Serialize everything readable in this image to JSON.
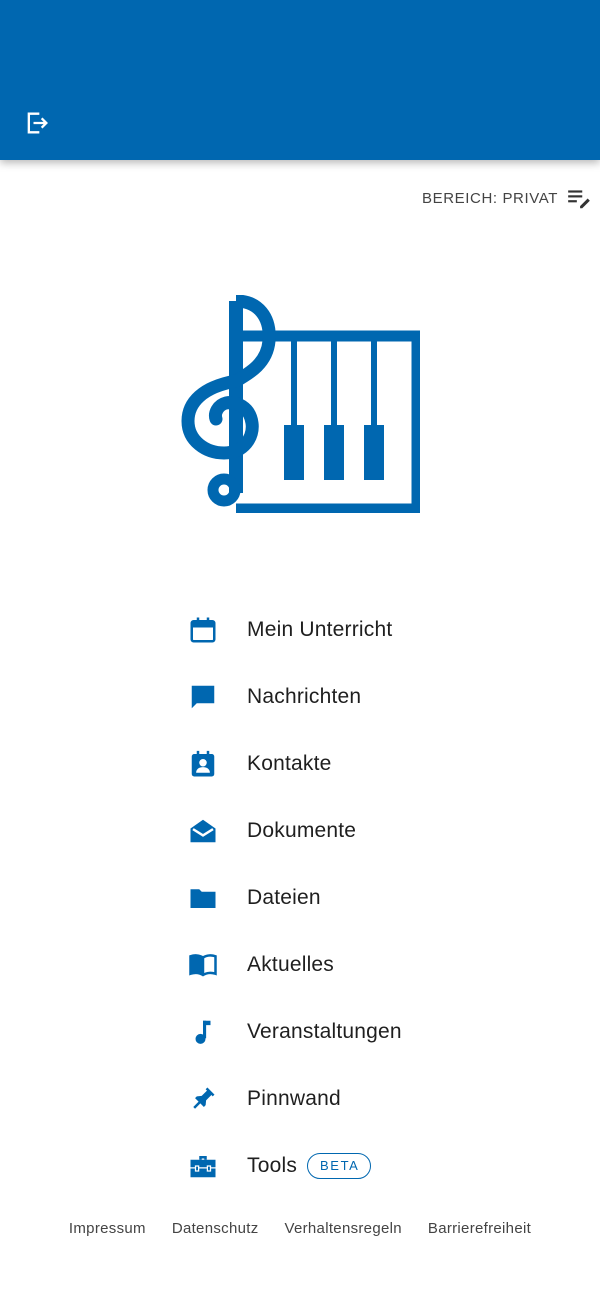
{
  "header": {
    "logout_icon": "logout-icon",
    "background_color": "#0067b0"
  },
  "area": {
    "label": "BEREICH: PRIVAT",
    "icon": "edit-list-icon"
  },
  "logo": {
    "icon": "treble-clef-piano-logo",
    "color": "#0067b0"
  },
  "menu": {
    "items": [
      {
        "label": "Mein Unterricht",
        "icon": "calendar-icon"
      },
      {
        "label": "Nachrichten",
        "icon": "chat-icon"
      },
      {
        "label": "Kontakte",
        "icon": "contact-card-icon"
      },
      {
        "label": "Dokumente",
        "icon": "envelope-open-icon"
      },
      {
        "label": "Dateien",
        "icon": "folder-icon"
      },
      {
        "label": "Aktuelles",
        "icon": "book-open-icon"
      },
      {
        "label": "Veranstaltungen",
        "icon": "music-note-icon"
      },
      {
        "label": "Pinnwand",
        "icon": "pin-icon"
      },
      {
        "label": "Tools",
        "icon": "toolbox-icon",
        "badge": "BETA"
      }
    ]
  },
  "footer": {
    "links": [
      "Impressum",
      "Datenschutz",
      "Verhaltensregeln",
      "Barrierefreiheit"
    ]
  },
  "colors": {
    "accent": "#0067b0",
    "text": "#1f1f1f",
    "muted": "#444444"
  }
}
